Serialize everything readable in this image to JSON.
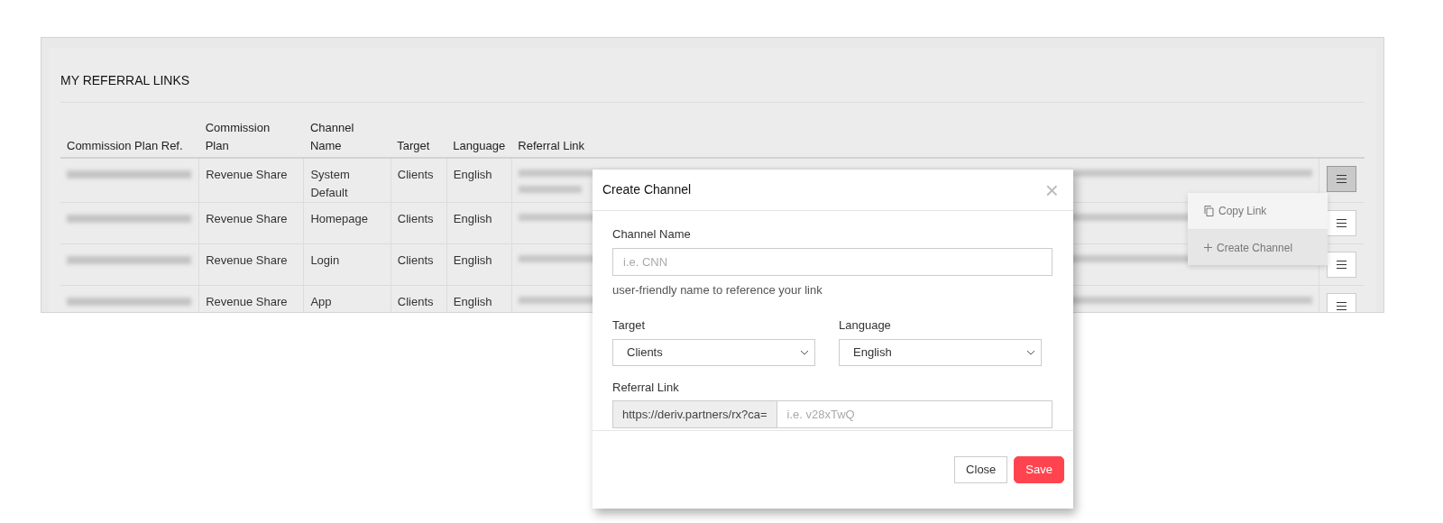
{
  "panel": {
    "title": "MY REFERRAL LINKS"
  },
  "table": {
    "columns": [
      "Commission Plan Ref.",
      "Commission Plan",
      "Channel Name",
      "Target",
      "Language",
      "Referral Link"
    ],
    "rows": [
      {
        "plan": "Revenue Share",
        "channel": "System Default",
        "target": "Clients",
        "language": "English",
        "menu_open": true
      },
      {
        "plan": "Revenue Share",
        "channel": "Homepage",
        "target": "Clients",
        "language": "English",
        "menu_open": false
      },
      {
        "plan": "Revenue Share",
        "channel": "Login",
        "target": "Clients",
        "language": "English",
        "menu_open": false
      },
      {
        "plan": "Revenue Share",
        "channel": "App",
        "target": "Clients",
        "language": "English",
        "menu_open": false
      }
    ]
  },
  "row_menu": {
    "items": [
      {
        "kind": "copy",
        "label": "Copy Link",
        "selected": false
      },
      {
        "kind": "create",
        "label": "Create Channel",
        "selected": true
      }
    ]
  },
  "dialog": {
    "title": "Create Channel",
    "close_glyph": "×",
    "channel_name": {
      "label": "Channel Name",
      "placeholder": "i.e. CNN",
      "help": "user-friendly name to reference your link"
    },
    "target": {
      "label": "Target",
      "value": "Clients"
    },
    "language": {
      "label": "Language",
      "value": "English"
    },
    "referral_link": {
      "label": "Referral Link",
      "prefix": "https://deriv.partners/rx?ca=",
      "placeholder": "i.e. v28xTwQ"
    },
    "buttons": [
      {
        "kind": "secondary",
        "label": "Close"
      },
      {
        "kind": "primary",
        "label": "Save"
      }
    ]
  }
}
